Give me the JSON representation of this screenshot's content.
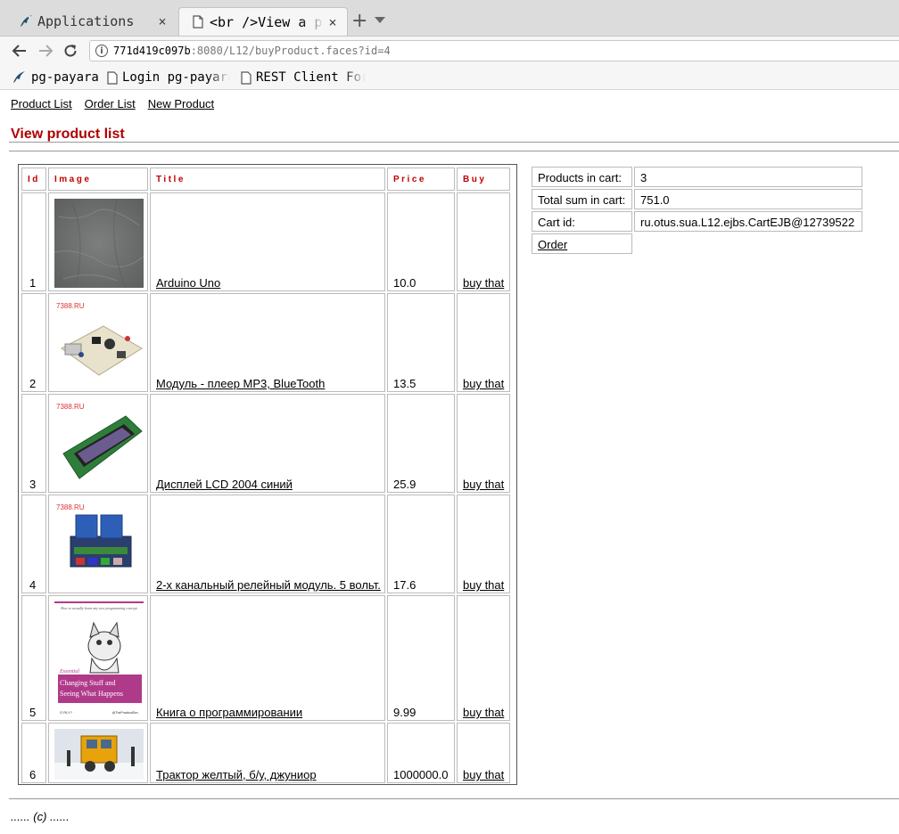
{
  "browser": {
    "tabs": [
      {
        "title": "Applications",
        "close": "×"
      },
      {
        "title": "<br />View a product list",
        "close": "×"
      }
    ],
    "new_tab": "+",
    "url_host": "771d419c097b",
    "url_rest": ":8080/L12/buyProduct.faces?id=4",
    "bookmarks": [
      "pg-payara",
      "Login pg-payara",
      "REST Client For"
    ]
  },
  "nav": {
    "links": [
      "Product List",
      "Order List",
      "New Product"
    ]
  },
  "heading": "View product list",
  "table": {
    "headers": [
      "Id",
      "Image",
      "Title",
      "Price",
      "Buy"
    ],
    "rows": [
      {
        "id": "1",
        "title": "Arduino Uno",
        "price": "10.0",
        "buy": "buy that"
      },
      {
        "id": "2",
        "title": "Модуль - плеер MP3, BlueTooth",
        "price": "13.5",
        "buy": "buy that"
      },
      {
        "id": "3",
        "title": "Дисплей LCD 2004 синий",
        "price": "25.9",
        "buy": "buy that"
      },
      {
        "id": "4",
        "title": "2-х канальный релейный модуль. 5 вольт.",
        "price": "17.6",
        "buy": "buy that"
      },
      {
        "id": "5",
        "title": "Книга о программировании",
        "price": "9.99",
        "buy": "buy that"
      },
      {
        "id": "6",
        "title": "Трактор желтый, б/у, джуниор",
        "price": "1000000.0",
        "buy": "buy that"
      }
    ]
  },
  "images": {
    "watermark": "7388.RU",
    "book_top": "How to actually learn any new programming concept",
    "book_label": "Essential",
    "book_line1": "Changing Stuff and",
    "book_line2": "Seeing What Happens",
    "book_pub": "O RLY?",
    "book_author": "@ThePracticalDev"
  },
  "cart": {
    "products_label": "Products in cart:",
    "products_value": "3",
    "sum_label": "Total sum in cart:",
    "sum_value": "751.0",
    "id_label": "Cart id:",
    "id_value": "ru.otus.sua.L12.ejbs.CartEJB@12739522",
    "order": "Order"
  },
  "footer": "...... (c) ......"
}
